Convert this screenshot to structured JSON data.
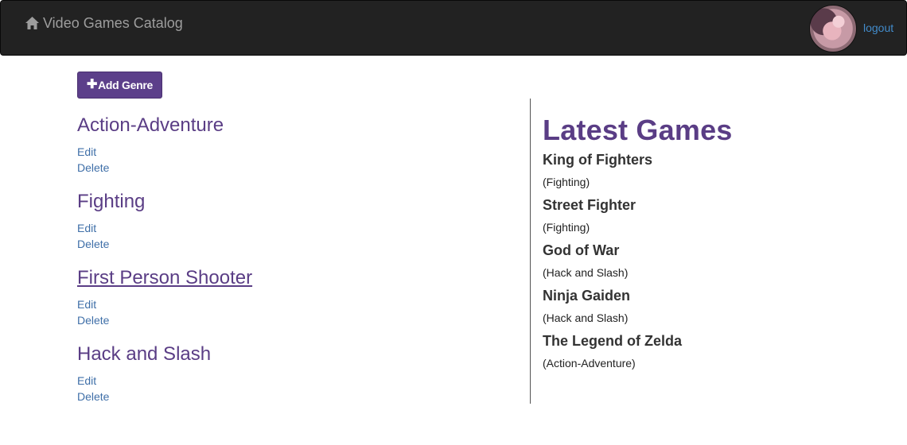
{
  "navbar": {
    "brand": "Video Games Catalog",
    "brand_icon": "home-icon",
    "logout_label": "logout"
  },
  "add_genre_label": "Add Genre",
  "genres": [
    {
      "title": "Action-Adventure",
      "edit": "Edit",
      "delete": "Delete"
    },
    {
      "title": "Fighting",
      "edit": "Edit",
      "delete": "Delete"
    },
    {
      "title": "First Person Shooter",
      "edit": "Edit",
      "delete": "Delete"
    },
    {
      "title": "Hack and Slash",
      "edit": "Edit",
      "delete": "Delete"
    }
  ],
  "latest": {
    "title": "Latest Games",
    "games": [
      {
        "name": "King of Fighters",
        "genre": "(Fighting)"
      },
      {
        "name": "Street Fighter",
        "genre": "(Fighting)"
      },
      {
        "name": "God of War",
        "genre": "(Hack and Slash)"
      },
      {
        "name": "Ninja Gaiden",
        "genre": "(Hack and Slash)"
      },
      {
        "name": "The Legend of Zelda",
        "genre": "(Action-Adventure)"
      }
    ]
  },
  "colors": {
    "navbar_bg": "#222222",
    "accent_purple": "#5a3d85",
    "link_blue": "#3f6fa8"
  }
}
